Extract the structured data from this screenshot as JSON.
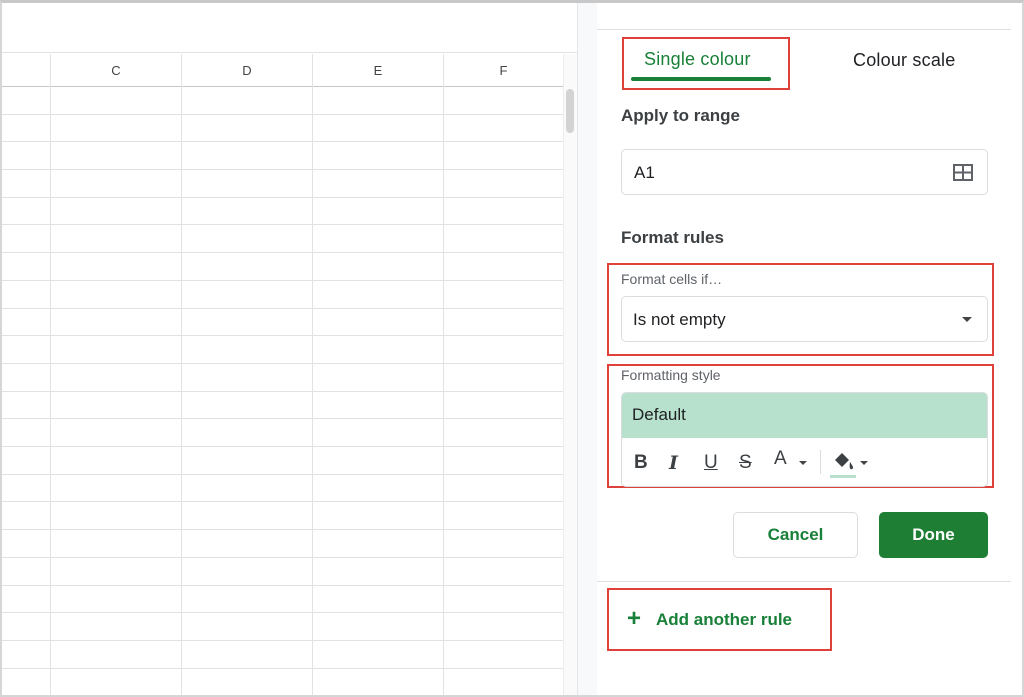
{
  "sheet": {
    "columns": [
      "C",
      "D",
      "E",
      "F"
    ]
  },
  "panel": {
    "tabs": [
      {
        "label": "Single colour",
        "active": true
      },
      {
        "label": "Colour scale",
        "active": false
      }
    ],
    "apply_to_range": {
      "label": "Apply to range",
      "value": "A1",
      "icon": "grid-icon"
    },
    "format_rules": {
      "heading": "Format rules",
      "condition_label": "Format cells if…",
      "condition_value": "Is not empty",
      "style_label": "Formatting style",
      "style_preview": "Default",
      "style_preview_color": "#b7e1cd",
      "tools": {
        "bold": "B",
        "italic": "I",
        "underline": "U",
        "strikethrough": "S",
        "text_color": "A"
      }
    },
    "buttons": {
      "cancel": "Cancel",
      "done": "Done"
    },
    "add_rule": {
      "icon": "+",
      "label": "Add another rule"
    }
  },
  "colors": {
    "accent_green": "#188038",
    "done_button": "#1e7e34",
    "highlight_box": "#e0403a"
  }
}
